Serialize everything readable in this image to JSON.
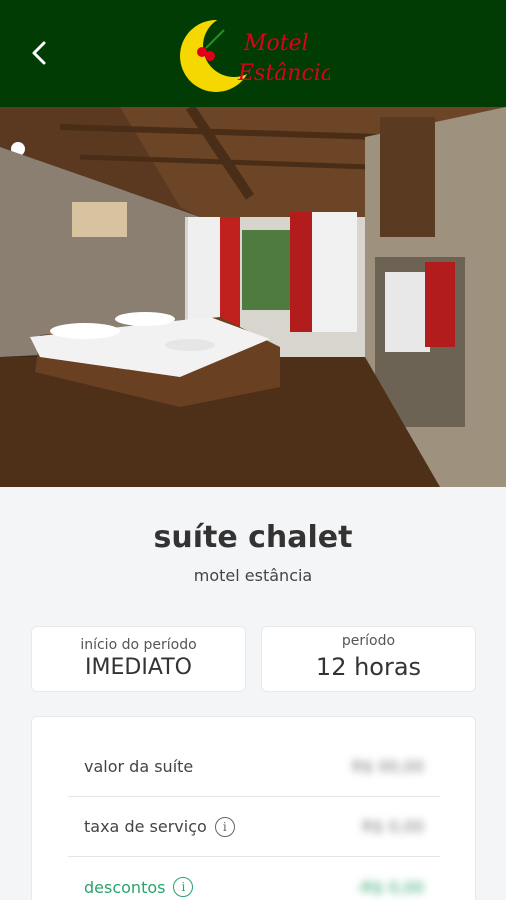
{
  "header": {
    "brand_line1": "Motel",
    "brand_line2": "Estância",
    "back_icon": "chevron-left-icon",
    "bg_color": "#003c04",
    "accent_red": "#e0001a",
    "accent_yellow": "#f4d800"
  },
  "gallery": {
    "slide_count": 12,
    "active_index": 0
  },
  "suite": {
    "name": "suíte chalet",
    "motel": "motel estância"
  },
  "period_start": {
    "label": "início do período",
    "value": "IMEDIATO"
  },
  "period": {
    "label": "período",
    "value": "12 horas"
  },
  "pricing": {
    "suite_value_label": "valor da suíte",
    "suite_value": "R$ 00,00",
    "service_fee_label": "taxa de serviço",
    "service_fee": "R$ 0,00",
    "discounts_label": "descontos",
    "discounts": "-R$ 0,00",
    "discount_color": "#2aa36a",
    "info_icon": "info-circle-icon"
  }
}
